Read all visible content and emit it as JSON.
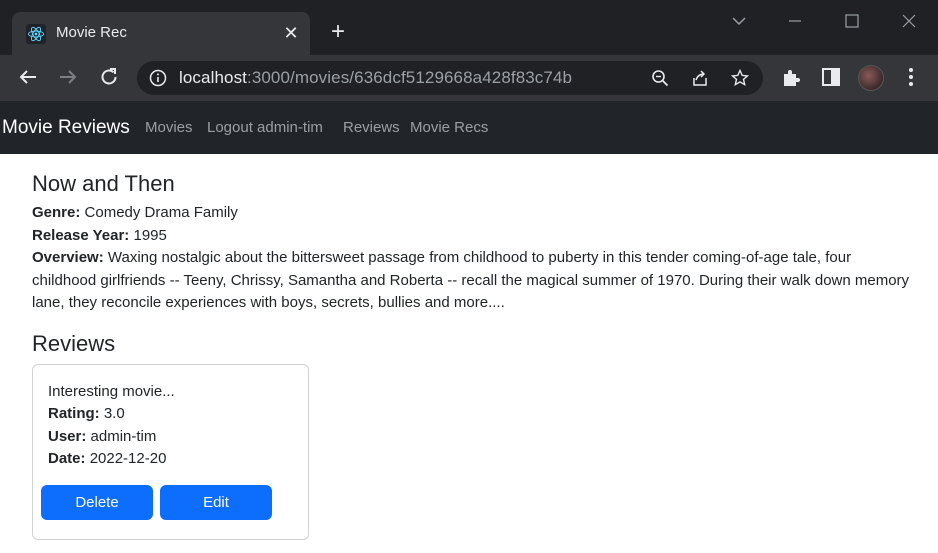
{
  "browser": {
    "tab_title": "Movie Rec",
    "url_host": "localhost",
    "url_path": ":3000/movies/636dcf5129668a428f83c74b"
  },
  "navbar": {
    "brand": "Movie Reviews",
    "links": [
      "Movies",
      "Logout admin-tim",
      "Reviews",
      "Movie Recs"
    ]
  },
  "movie": {
    "title": "Now and Then",
    "genre_label": "Genre:",
    "genre": "Comedy Drama Family",
    "year_label": "Release Year:",
    "year": "1995",
    "overview_label": "Overview:",
    "overview_line1": "Waxing nostalgic about the bittersweet passage from childhood to puberty in this tender coming-of-age tale, four",
    "overview_line2": "childhood girlfriends -- Teeny, Chrissy, Samantha and Roberta -- recall the magical summer of 1970. During their walk down memory",
    "overview_line3": "lane, they reconcile experiences with boys, secrets, bullies and more...."
  },
  "reviews": {
    "heading": "Reviews",
    "items": [
      {
        "text": "Interesting movie...",
        "rating_label": "Rating:",
        "rating": "3.0",
        "user_label": "User:",
        "user": "admin-tim",
        "date_label": "Date:",
        "date": "2022-12-20",
        "delete_label": "Delete",
        "edit_label": "Edit"
      }
    ]
  },
  "colors": {
    "navbar_bg": "#212529",
    "primary": "#0d6efd",
    "chrome_dark": "#202124",
    "chrome_toolbar": "#35363a"
  }
}
